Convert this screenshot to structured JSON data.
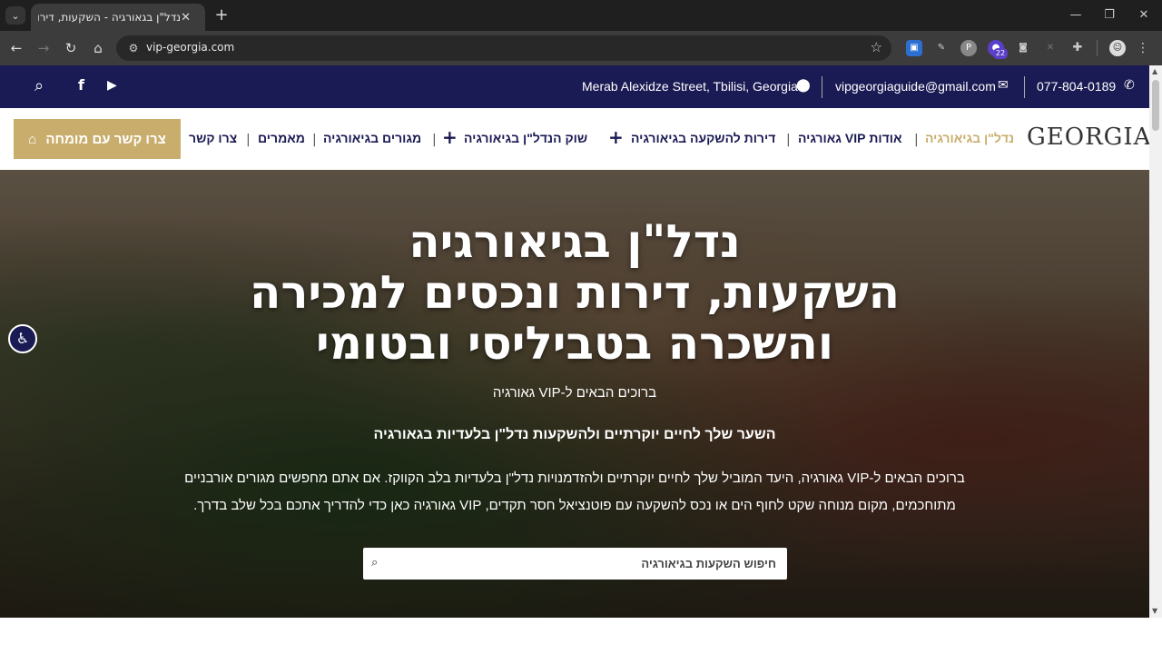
{
  "browser": {
    "tab_title": "נדל\"ן בגאורגיה - השקעות, דירות",
    "url": "vip-georgia.com",
    "ext_badge": "22"
  },
  "topbar": {
    "phone": "077-804-0189",
    "email": "vipgeorgiaguide@gmail.com",
    "address": "Merab Alexidze Street, Tbilisi, Georgia"
  },
  "nav": {
    "logo": "GEORGIA",
    "items": [
      "נדל\"ן בגיאורגיה",
      "אודות VIP גאורגיה",
      "דירות להשקעה בגיאורגיה",
      "שוק הנדל\"ן בגיאורגיה",
      "מגורים בגיאורגיה",
      "מאמרים",
      "צרו קשר"
    ],
    "cta": "צרו קשר עם מומחה"
  },
  "hero": {
    "line1": "נדל\"ן בגיאורגיה",
    "line2": "השקעות, דירות ונכסים למכירה",
    "line3": "והשכרה בטביליסי ובטומי",
    "welcome": "ברוכים הבאים ל-VIP גאורגיה",
    "gateway": "השער שלך לחיים יוקרתיים ולהשקעות נדל\"ן בלעדיות בגאורגיה",
    "paragraph": "ברוכים הבאים ל-VIP גאורגיה, היעד המוביל שלך לחיים יוקרתיים ולהזדמנויות נדל\"ן בלעדיות בלב הקווקז. אם אתם מחפשים מגורים אורבניים מתוחכמים, מקום מנוחה שקט לחוף הים או נכס להשקעה עם פוטנציאל חסר תקדים, VIP גאורגיה כאן כדי להדריך אתכם בכל שלב בדרך.",
    "search_placeholder": "חיפוש השקעות בגיאורגיה"
  }
}
